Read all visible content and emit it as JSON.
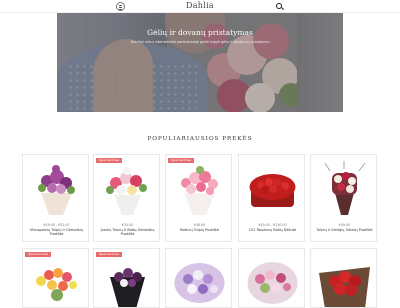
{
  "header": {
    "logo": "Dahlia",
    "menu_icon": "hamburger-menu-icon",
    "search_icon": "search-icon"
  },
  "hero": {
    "title": "Gėlių ir dovanų pristatymas",
    "subtitle": "Nuo šiol mūsų internetinėje parduotuvėje galite įsigyti gėlių ir dovanų su pristatymu"
  },
  "section": {
    "title": "POPULIARIAUSIOS PREKĖS"
  },
  "products": [
    {
      "price": "€49.00 – €52.00",
      "name": "Vienspalvių Tulpių Ir Gėmelbių Puokštė",
      "badge": ""
    },
    {
      "price": "€34.00",
      "name": "Įvairių Tulpių Ir Baltų Gėmelbių Puokštė",
      "badge": "Išpardavimas"
    },
    {
      "price": "€46.00",
      "name": "Rožinių Tulpių Puokštė",
      "badge": "Išpardavimas"
    },
    {
      "price": "€49.00 – €130.00",
      "name": "101 Raudonų Rožių Dėžutė",
      "badge": ""
    },
    {
      "price": "€49.00",
      "name": "Tulpių Ir Smilgių Gėlelių Puokštė",
      "badge": ""
    }
  ],
  "products_row2": [
    {
      "badge": "Išpardavimas"
    },
    {
      "badge": "Išpardavimas"
    },
    {
      "badge": ""
    },
    {
      "badge": ""
    },
    {
      "badge": ""
    }
  ],
  "colors": {
    "badge": "#e76b6b",
    "text": "#333333"
  }
}
